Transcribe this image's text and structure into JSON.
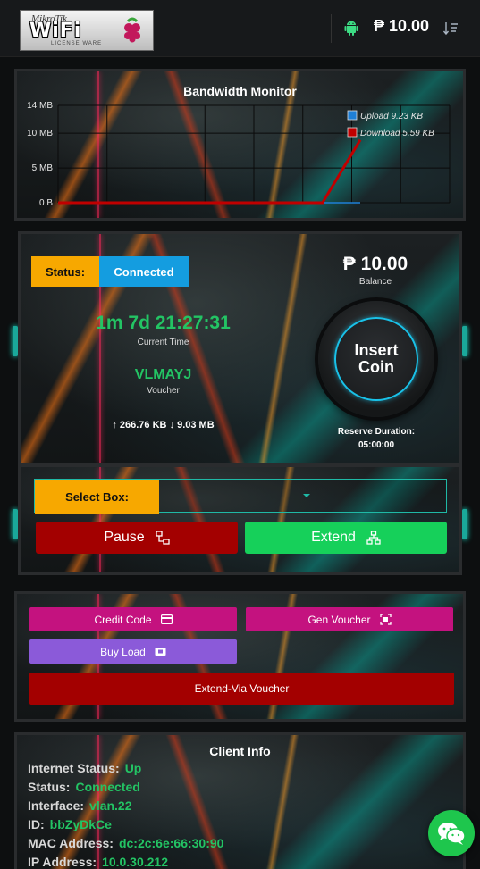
{
  "header": {
    "logo": {
      "brand_small": "MikroTik",
      "brand_big": "WiFi",
      "tagline": "LICENSE WARE"
    },
    "balance": "₱ 10.00"
  },
  "bandwidth": {
    "title": "Bandwidth Monitor",
    "chart_data": {
      "type": "line",
      "title": "Bandwidth Monitor",
      "y_ticks": [
        "14 MB",
        "10 MB",
        "5 MB",
        "0 B"
      ],
      "ylim": [
        0,
        14
      ],
      "y_unit": "MB",
      "grid": true,
      "legend_position": "top-right",
      "series": [
        {
          "name": "Upload 9.23 KB",
          "color": "#1e7fd6",
          "values": [
            0,
            0,
            0,
            0,
            0,
            0,
            0,
            0,
            0
          ]
        },
        {
          "name": "Download 5.59 KB",
          "color": "#c00000",
          "values": [
            0,
            0,
            0,
            0,
            0,
            0,
            0,
            0,
            9.03
          ]
        }
      ]
    }
  },
  "session": {
    "status_label": "Status:",
    "status_value": "Connected",
    "balance_amount": "₱ 10.00",
    "balance_label": "Balance",
    "time_value": "1m 7d 21:27:31",
    "time_label": "Current Time",
    "voucher_value": "VLMAYJ",
    "voucher_label": "Voucher",
    "traffic": "↑ 266.76 KB ↓ 9.03 MB",
    "insert_coin_line1": "Insert",
    "insert_coin_line2": "Coin",
    "reserve_label": "Reserve Duration:",
    "reserve_value": "05:00:00"
  },
  "controls": {
    "select_label": "Select Box:",
    "pause_label": "Pause",
    "extend_label": "Extend"
  },
  "actions": {
    "credit_code": "Credit Code",
    "gen_voucher": "Gen Voucher",
    "buy_load": "Buy Load",
    "extend_via_voucher": "Extend-Via Voucher"
  },
  "client": {
    "title": "Client Info",
    "rows": [
      {
        "key": "Internet Status:",
        "value": "Up"
      },
      {
        "key": "Status:",
        "value": "Connected"
      },
      {
        "key": "Interface:",
        "value": "vlan.22"
      },
      {
        "key": "ID:",
        "value": "bbZyDkCe"
      },
      {
        "key": "MAC Address:",
        "value": "dc:2c:6e:66:30:90"
      },
      {
        "key": "IP Address:",
        "value": "10.0.30.212"
      }
    ]
  },
  "colors": {
    "accent_green": "#23c464",
    "status_orange": "#f7a800",
    "status_blue": "#149de0",
    "danger_red": "#a30000",
    "magenta": "#c4127f",
    "purple": "#8b5ad9"
  }
}
